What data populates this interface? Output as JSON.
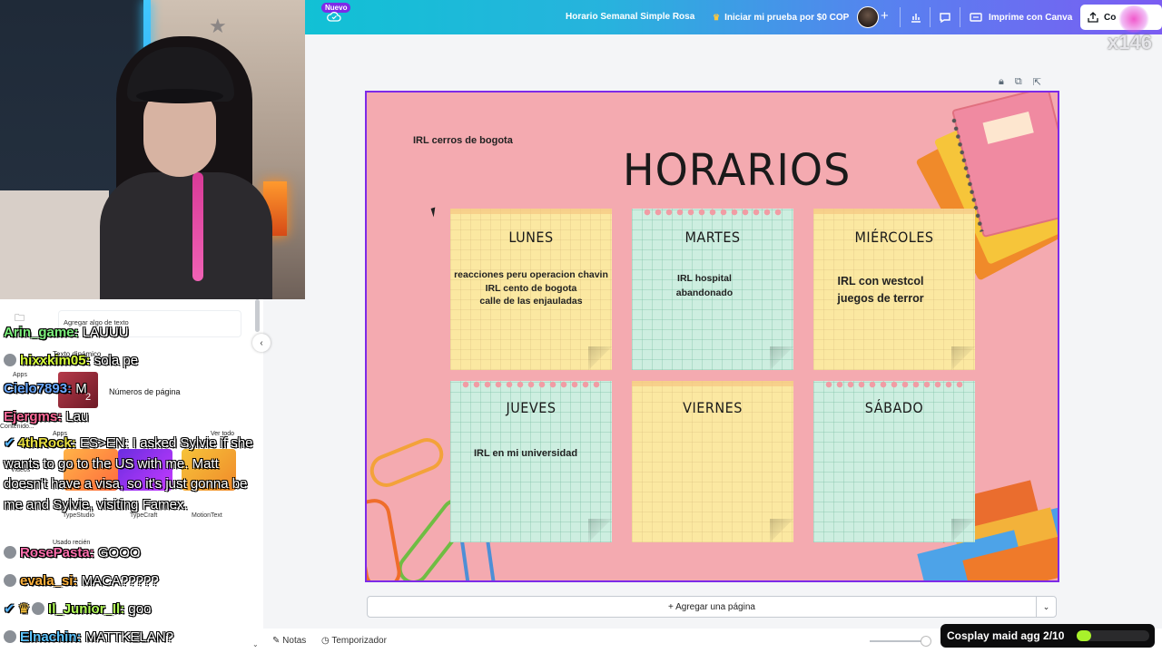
{
  "topbar": {
    "badge": "Nuevo",
    "doc_title": "Horario Semanal Simple Rosa",
    "trial_button": "Iniciar mi prueba por $0 COP",
    "print_button": "Imprime con Canva",
    "share_button": "Co",
    "overlay_counter": "x146"
  },
  "left_panel": {
    "rail": [
      {
        "label": "Apps"
      },
      {
        "label": "Contenido..."
      },
      {
        "label": "Videos"
      },
      {
        "label": "Apps"
      }
    ],
    "input_placeholder": "Agregar algo de texto",
    "dynamic_text_heading": "Texto dinámico",
    "page_numbers_label": "Números de página",
    "see_all": "Ver todo",
    "apps_heading": "Apps",
    "apps": [
      "TypeStudio",
      "TypeCraft",
      "MotionText"
    ],
    "recent_heading": "Usado recién"
  },
  "chat": [
    {
      "user": "Arin_game:",
      "msg": "LAUUU",
      "color": "#7cf07c"
    },
    {
      "user": "hixxkim05:",
      "msg": "sola pe",
      "color": "#d8ff3a"
    },
    {
      "user": "Cielo7893:",
      "msg": "M",
      "color": "#6aa8ff"
    },
    {
      "user": "Ejergms:",
      "msg": "Lau",
      "color": "#ff6b9a"
    },
    {
      "user": "4thRock:",
      "msg": "ES>EN: I asked Sylvie if she wants to go to the US with me. Matt doesn't have a visa, so it's just gonna be me and Sylvie, visiting Famex.",
      "color": "#e8e040"
    },
    {
      "user": "RosePasta:",
      "msg": "GOOO",
      "color": "#ff6fae"
    },
    {
      "user": "evala_si:",
      "msg": "MACA?????",
      "color": "#ffb13b"
    },
    {
      "user": "Il_Junior_Il:",
      "msg": "goo",
      "color": "#b4ff5a"
    },
    {
      "user": "Elnachin:",
      "msg": "MATTKELAN?",
      "color": "#5ec5ff"
    }
  ],
  "design": {
    "subtitle": "IRL cerros de bogota",
    "title": "HORARIOS",
    "days": [
      {
        "day": "LUNES",
        "activity": "reacciones peru operacion chavin\nIRL cento de bogota\ncalle de las enjauladas"
      },
      {
        "day": "MARTES",
        "activity": "IRL hospital\nabandonado"
      },
      {
        "day": "MIÉRCOLES",
        "activity": "IRL con westcol\njuegos de terror"
      },
      {
        "day": "JUEVES",
        "activity": "IRL en mi universidad"
      },
      {
        "day": "VIERNES",
        "activity": ""
      },
      {
        "day": "SÁBADO",
        "activity": ""
      }
    ]
  },
  "bottom": {
    "add_page": "+ Agregar una página",
    "notes": "Notas",
    "timer": "Temporizador",
    "cosplay_goal": "Cosplay maid agg 2/10",
    "cosplay_progress": 0.2
  },
  "colors": {
    "canvas_bg": "#f4aab0",
    "note_yellow": "#fbe8a1",
    "note_mint": "#cdeee0",
    "selection": "#7d2ae8"
  }
}
